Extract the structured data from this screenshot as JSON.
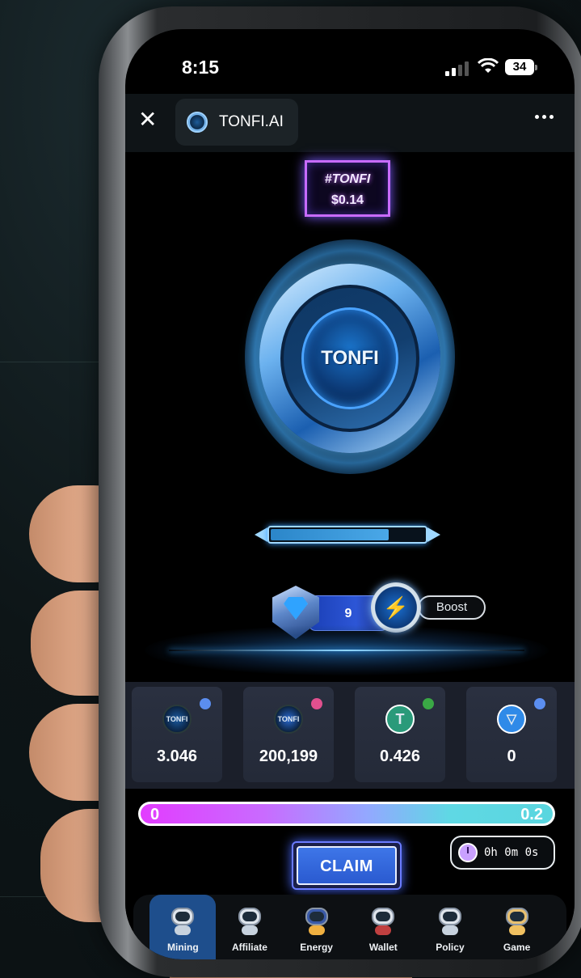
{
  "status_bar": {
    "time": "8:15",
    "battery": "34"
  },
  "app_bar": {
    "title": "TONFI.AI"
  },
  "price": {
    "symbol": "#TONFI",
    "value": "$0.14"
  },
  "coin": {
    "label": "TONFI"
  },
  "mining_progress": 0.75,
  "level": {
    "value": "9",
    "boost_label": "Boost"
  },
  "balances": [
    {
      "icon": "tonfi-coin-icon",
      "value": "3.046",
      "dot_color": "#5b8ef0"
    },
    {
      "icon": "tonfi-token-icon",
      "value": "200,199",
      "dot_color": "#e0508e"
    },
    {
      "icon": "usdt-icon",
      "value": "0.426",
      "dot_color": "#3aa845"
    },
    {
      "icon": "ton-icon",
      "value": "0",
      "dot_color": "#5b8ef0"
    }
  ],
  "claim_bar": {
    "min": "0",
    "max": "0.2"
  },
  "claim_button": "CLAIM",
  "timer": "0h 0m 0s",
  "nav": [
    {
      "label": "Mining",
      "active": true
    },
    {
      "label": "Affiliate",
      "active": false
    },
    {
      "label": "Energy",
      "active": false
    },
    {
      "label": "Wallet",
      "active": false
    },
    {
      "label": "Policy",
      "active": false
    },
    {
      "label": "Game",
      "active": false
    }
  ]
}
